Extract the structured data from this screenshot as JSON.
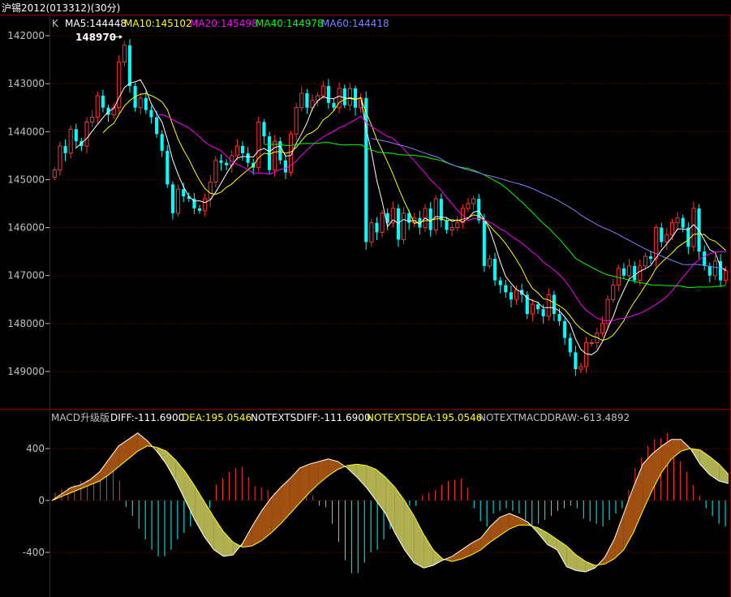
{
  "window": {
    "title": "沪锡2012(013312)(30分)"
  },
  "colors": {
    "up": "#ff3232",
    "down": "#00ffff",
    "grid": "#8a0000",
    "axis_text": "#c0c0c0",
    "ma5": "#ffffff",
    "ma10": "#ffff00",
    "ma20": "#ff00ff",
    "ma40": "#00ff00",
    "ma60": "#8080ff",
    "diff": "#ffffff",
    "dea": "#ffff00",
    "macd_fill_up": "#a05010",
    "macd_fill_down": "#b0b050"
  },
  "price_panel": {
    "legend": [
      {
        "key": "k",
        "text": "K",
        "color": "#c0c0c0"
      },
      {
        "key": "ma5",
        "text": "MA5:144448",
        "color": "#ffffff"
      },
      {
        "key": "ma10",
        "text": "MA10:145102",
        "color": "#ffff00"
      },
      {
        "key": "ma20",
        "text": "MA20:145498",
        "color": "#ff00ff"
      },
      {
        "key": "ma40",
        "text": "MA40:144978",
        "color": "#00ff00"
      },
      {
        "key": "ma60",
        "text": "MA60:144418",
        "color": "#8080ff"
      }
    ],
    "high_marker": "148970",
    "y_ticks": [
      "149000",
      "148000",
      "147000",
      "146000",
      "145000",
      "144000",
      "143000",
      "142000"
    ]
  },
  "macd_panel": {
    "legend": [
      {
        "key": "name",
        "text": "MACD升级版",
        "color": "#c0c0c0"
      },
      {
        "key": "diff",
        "text": "DIFF:-111.6900",
        "color": "#ffffff"
      },
      {
        "key": "dea",
        "text": "DEA:195.0546",
        "color": "#ffff00"
      },
      {
        "key": "ntdiff",
        "text": "NOTEXTSDIFF:-111.6900",
        "color": "#ffffff"
      },
      {
        "key": "ntdea",
        "text": "NOTEXTSDEA:195.0546",
        "color": "#ffff00"
      },
      {
        "key": "ntmacd",
        "text": "NOTEXTMACDDRAW:-613.4892",
        "color": "#c0c0c0"
      }
    ],
    "y_ticks": [
      "400",
      "0",
      "-400"
    ]
  },
  "chart_data": [
    {
      "type": "candlestick",
      "title": "沪锡2012(013312)(30分)",
      "ylim": [
        141700,
        149200
      ],
      "y_ticks": [
        142000,
        143000,
        144000,
        145000,
        146000,
        147000,
        148000,
        149000
      ],
      "grid": true,
      "high_label": {
        "value": 148970,
        "text": "148970"
      },
      "close": [
        146200,
        146700,
        146550,
        147050,
        146800,
        146700,
        147200,
        147300,
        147750,
        147500,
        147350,
        147500,
        148450,
        148800,
        147950,
        147500,
        147700,
        147450,
        147300,
        146950,
        146600,
        145900,
        145300,
        145800,
        145650,
        145600,
        145400,
        145350,
        145600,
        145950,
        146400,
        146350,
        146300,
        146500,
        146700,
        146550,
        146350,
        146250,
        147200,
        146900,
        146200,
        146800,
        146400,
        146150,
        146950,
        147500,
        147800,
        147500,
        147650,
        147750,
        147950,
        147600,
        147500,
        147900,
        147550,
        147900,
        147500,
        147700,
        144700,
        145100,
        144900,
        145300,
        145100,
        145400,
        144750,
        145300,
        145100,
        145200,
        145000,
        145400,
        144950,
        145600,
        145150,
        144950,
        145000,
        145100,
        145400,
        145500,
        145600,
        145150,
        144200,
        144350,
        143900,
        143800,
        143650,
        143500,
        143700,
        143600,
        143200,
        143400,
        143300,
        143150,
        143600,
        143200,
        143050,
        142700,
        142400,
        142050,
        142100,
        142600,
        142600,
        142800,
        143000,
        143500,
        143800,
        144150,
        144000,
        144200,
        143900,
        144200,
        144400,
        144350,
        145000,
        144700,
        144850,
        145100,
        145200,
        145000,
        144600,
        145400,
        144500,
        144200,
        144000,
        144300,
        143900,
        144100
      ]
    },
    {
      "type": "line",
      "title": "MACD升级版",
      "ylim": [
        -600,
        680
      ],
      "y_ticks": [
        400,
        0,
        -400
      ],
      "series": [
        {
          "name": "DIFF",
          "values": [
            0,
            50,
            100,
            120,
            160,
            220,
            320,
            420,
            470,
            520,
            460,
            380,
            280,
            150,
            0,
            -150,
            -280,
            -380,
            -430,
            -420,
            -330,
            -200,
            -80,
            20,
            100,
            170,
            250,
            280,
            300,
            320,
            300,
            250,
            180,
            100,
            0,
            -100,
            -250,
            -380,
            -480,
            -520,
            -500,
            -460,
            -430,
            -380,
            -330,
            -290,
            -200,
            -130,
            -100,
            -130,
            -170,
            -250,
            -340,
            -380,
            -510,
            -540,
            -550,
            -520,
            -440,
            -300,
            -100,
            100,
            280,
            360,
            420,
            470,
            470,
            400,
            280,
            200,
            150,
            130
          ]
        },
        {
          "name": "DEA",
          "values": [
            0,
            30,
            60,
            90,
            120,
            150,
            200,
            260,
            320,
            380,
            420,
            410,
            380,
            310,
            220,
            110,
            -10,
            -130,
            -240,
            -320,
            -360,
            -350,
            -310,
            -250,
            -180,
            -100,
            -20,
            60,
            130,
            190,
            240,
            270,
            280,
            270,
            240,
            180,
            100,
            0,
            -120,
            -260,
            -380,
            -450,
            -470,
            -450,
            -420,
            -380,
            -320,
            -270,
            -220,
            -190,
            -190,
            -210,
            -250,
            -300,
            -350,
            -420,
            -470,
            -500,
            -490,
            -450,
            -380,
            -250,
            -80,
            80,
            220,
            320,
            380,
            400,
            390,
            340,
            280,
            200
          ]
        }
      ],
      "histogram": [
        60,
        90,
        100,
        120,
        150,
        160,
        170,
        200,
        230,
        300,
        150,
        -50,
        -120,
        -220,
        -300,
        -380,
        -430,
        -430,
        -380,
        -300,
        -250,
        -200,
        -150,
        -100,
        -60,
        120,
        170,
        220,
        250,
        260,
        180,
        110,
        100,
        80,
        60,
        -20,
        60,
        100,
        100,
        80,
        40,
        -40,
        -50,
        -180,
        -320,
        -460,
        -560,
        -560,
        -480,
        -400,
        -380,
        -300,
        -220,
        -160,
        -120,
        -40,
        -40,
        40,
        60,
        80,
        120,
        150,
        160,
        170,
        100,
        -60,
        -160,
        -200,
        -100,
        -80,
        -60,
        -80,
        -100,
        -150,
        -200,
        -180,
        -150,
        -120,
        -80,
        -60,
        -40,
        -60,
        -140,
        -160,
        -180,
        -200,
        -150,
        -100,
        -60,
        80,
        250,
        330,
        420,
        470,
        480,
        520,
        400,
        300,
        220,
        120,
        40,
        -60,
        -120,
        -180,
        -200
      ]
    }
  ]
}
